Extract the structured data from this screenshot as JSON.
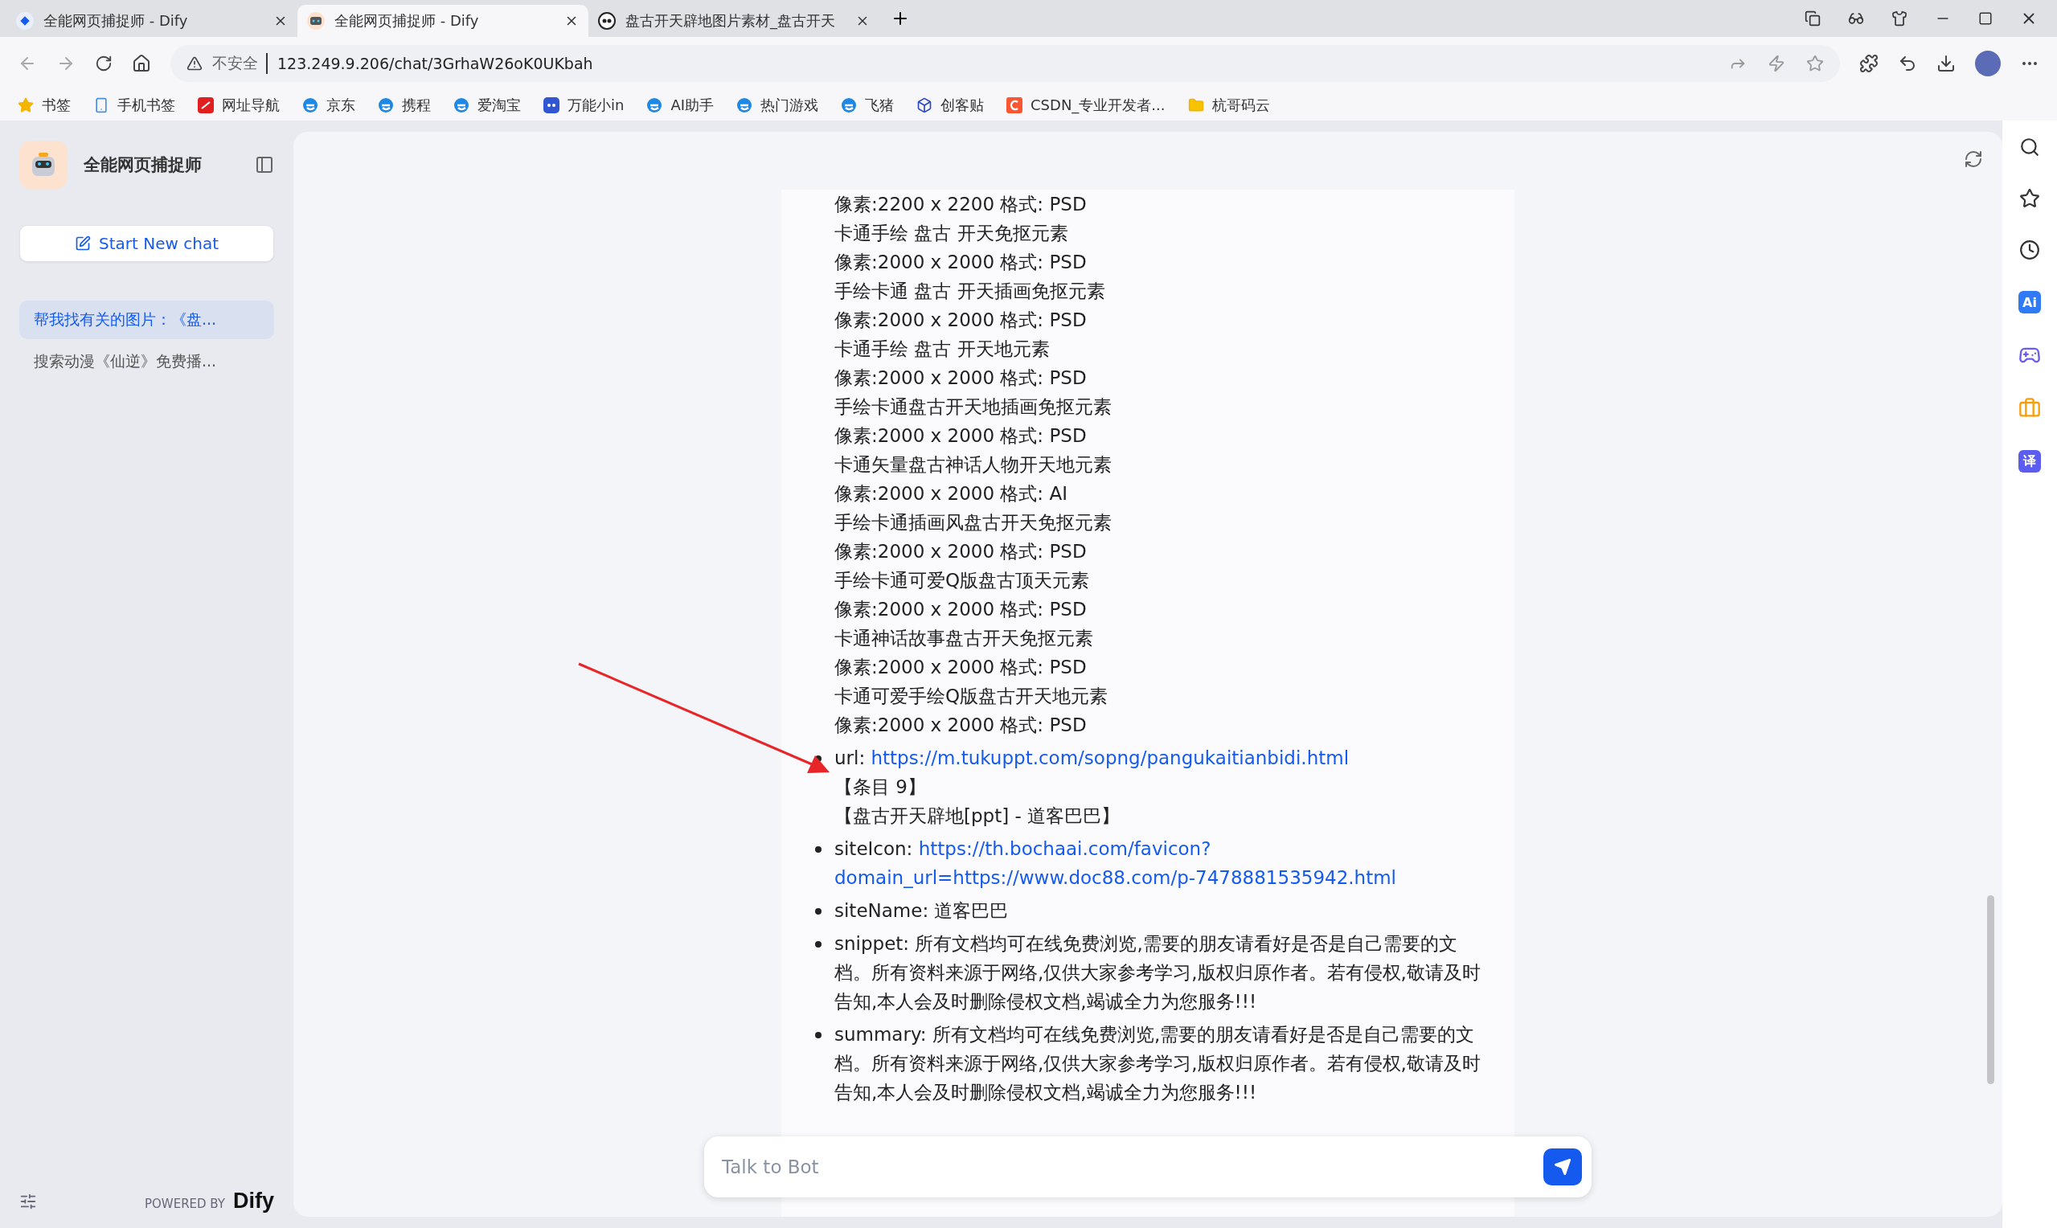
{
  "browser": {
    "tabs": [
      {
        "title": "全能网页捕捉师 - Dify",
        "selected": false
      },
      {
        "title": "全能网页捕捉师 - Dify",
        "selected": true
      },
      {
        "title": "盘古开天辟地图片素材_盘古开天",
        "selected": false
      }
    ],
    "address": {
      "security": "不安全",
      "url": "123.249.9.206/chat/3GrhaW26oK0UKbah"
    },
    "bookmarks": [
      "书签",
      "手机书签",
      "网址导航",
      "京东",
      "携程",
      "爱淘宝",
      "万能小in",
      "AI助手",
      "热门游戏",
      "飞猪",
      "创客贴",
      "CSDN_专业开发者...",
      "杭哥码云"
    ]
  },
  "sidebar": {
    "app_name": "全能网页捕捉师",
    "new_chat": "Start New chat",
    "conversations": [
      {
        "title": "帮我找有关的图片：《盘...",
        "selected": true
      },
      {
        "title": "搜索动漫《仙逆》免费播...",
        "selected": false
      }
    ],
    "powered_by": "POWERED BY",
    "brand": "Dify"
  },
  "chat": {
    "lines": [
      "像素:2200 x 2200 格式: PSD",
      "卡通手绘 盘古 开天免抠元素",
      "像素:2000 x 2000 格式: PSD",
      "手绘卡通 盘古 开天插画免抠元素",
      "像素:2000 x 2000 格式: PSD",
      "卡通手绘 盘古 开天地元素",
      "像素:2000 x 2000 格式: PSD",
      "手绘卡通盘古开天地插画免抠元素",
      "像素:2000 x 2000 格式: PSD",
      "卡通矢量盘古神话人物开天地元素",
      "像素:2000 x 2000 格式: AI",
      "手绘卡通插画风盘古开天免抠元素",
      "像素:2000 x 2000 格式: PSD",
      "手绘卡通可爱Q版盘古顶天元素",
      "像素:2000 x 2000 格式: PSD",
      "卡通神话故事盘古开天免抠元素",
      "像素:2000 x 2000 格式: PSD",
      "卡通可爱手绘Q版盘古开天地元素",
      "像素:2000 x 2000 格式: PSD"
    ],
    "items": [
      {
        "key": "url:",
        "link": [
          "https://m.tukuppt.com/sopng/pangukaitianbidi.html"
        ],
        "after": [
          "【条目 9】",
          "【盘古开天辟地[ppt] - 道客巴巴】"
        ]
      },
      {
        "key": "siteIcon:",
        "link": [
          "https://th.bochaai.com/favicon?",
          "domain_url=https://www.doc88.com/p-7478881535942.html"
        ]
      },
      {
        "key": "siteName:",
        "text": "道客巴巴"
      },
      {
        "key": "snippet:",
        "text": "所有文档均可在线免费浏览,需要的朋友请看好是否是自己需要的文档。所有资料来源于网络,仅供大家参考学习,版权归原作者。若有侵权,敬请及时告知,本人会及时删除侵权文档,竭诚全力为您服务!!!"
      },
      {
        "key": "summary:",
        "text": "所有文档均可在线免费浏览,需要的朋友请看好是否是自己需要的文档。所有资料来源于网络,仅供大家参考学习,版权归原作者。若有侵权,敬请及时告知,本人会及时删除侵权文档,竭诚全力为您服务!!!"
      }
    ],
    "placeholder": "Talk to Bot"
  },
  "rail": [
    {
      "kind": "search"
    },
    {
      "kind": "star"
    },
    {
      "kind": "clock"
    },
    {
      "kind": "text",
      "label": "Ai",
      "color": "#2f7bf5"
    },
    {
      "kind": "game"
    },
    {
      "kind": "case"
    },
    {
      "kind": "text",
      "label": "译",
      "color": "#5b5cf0"
    }
  ]
}
